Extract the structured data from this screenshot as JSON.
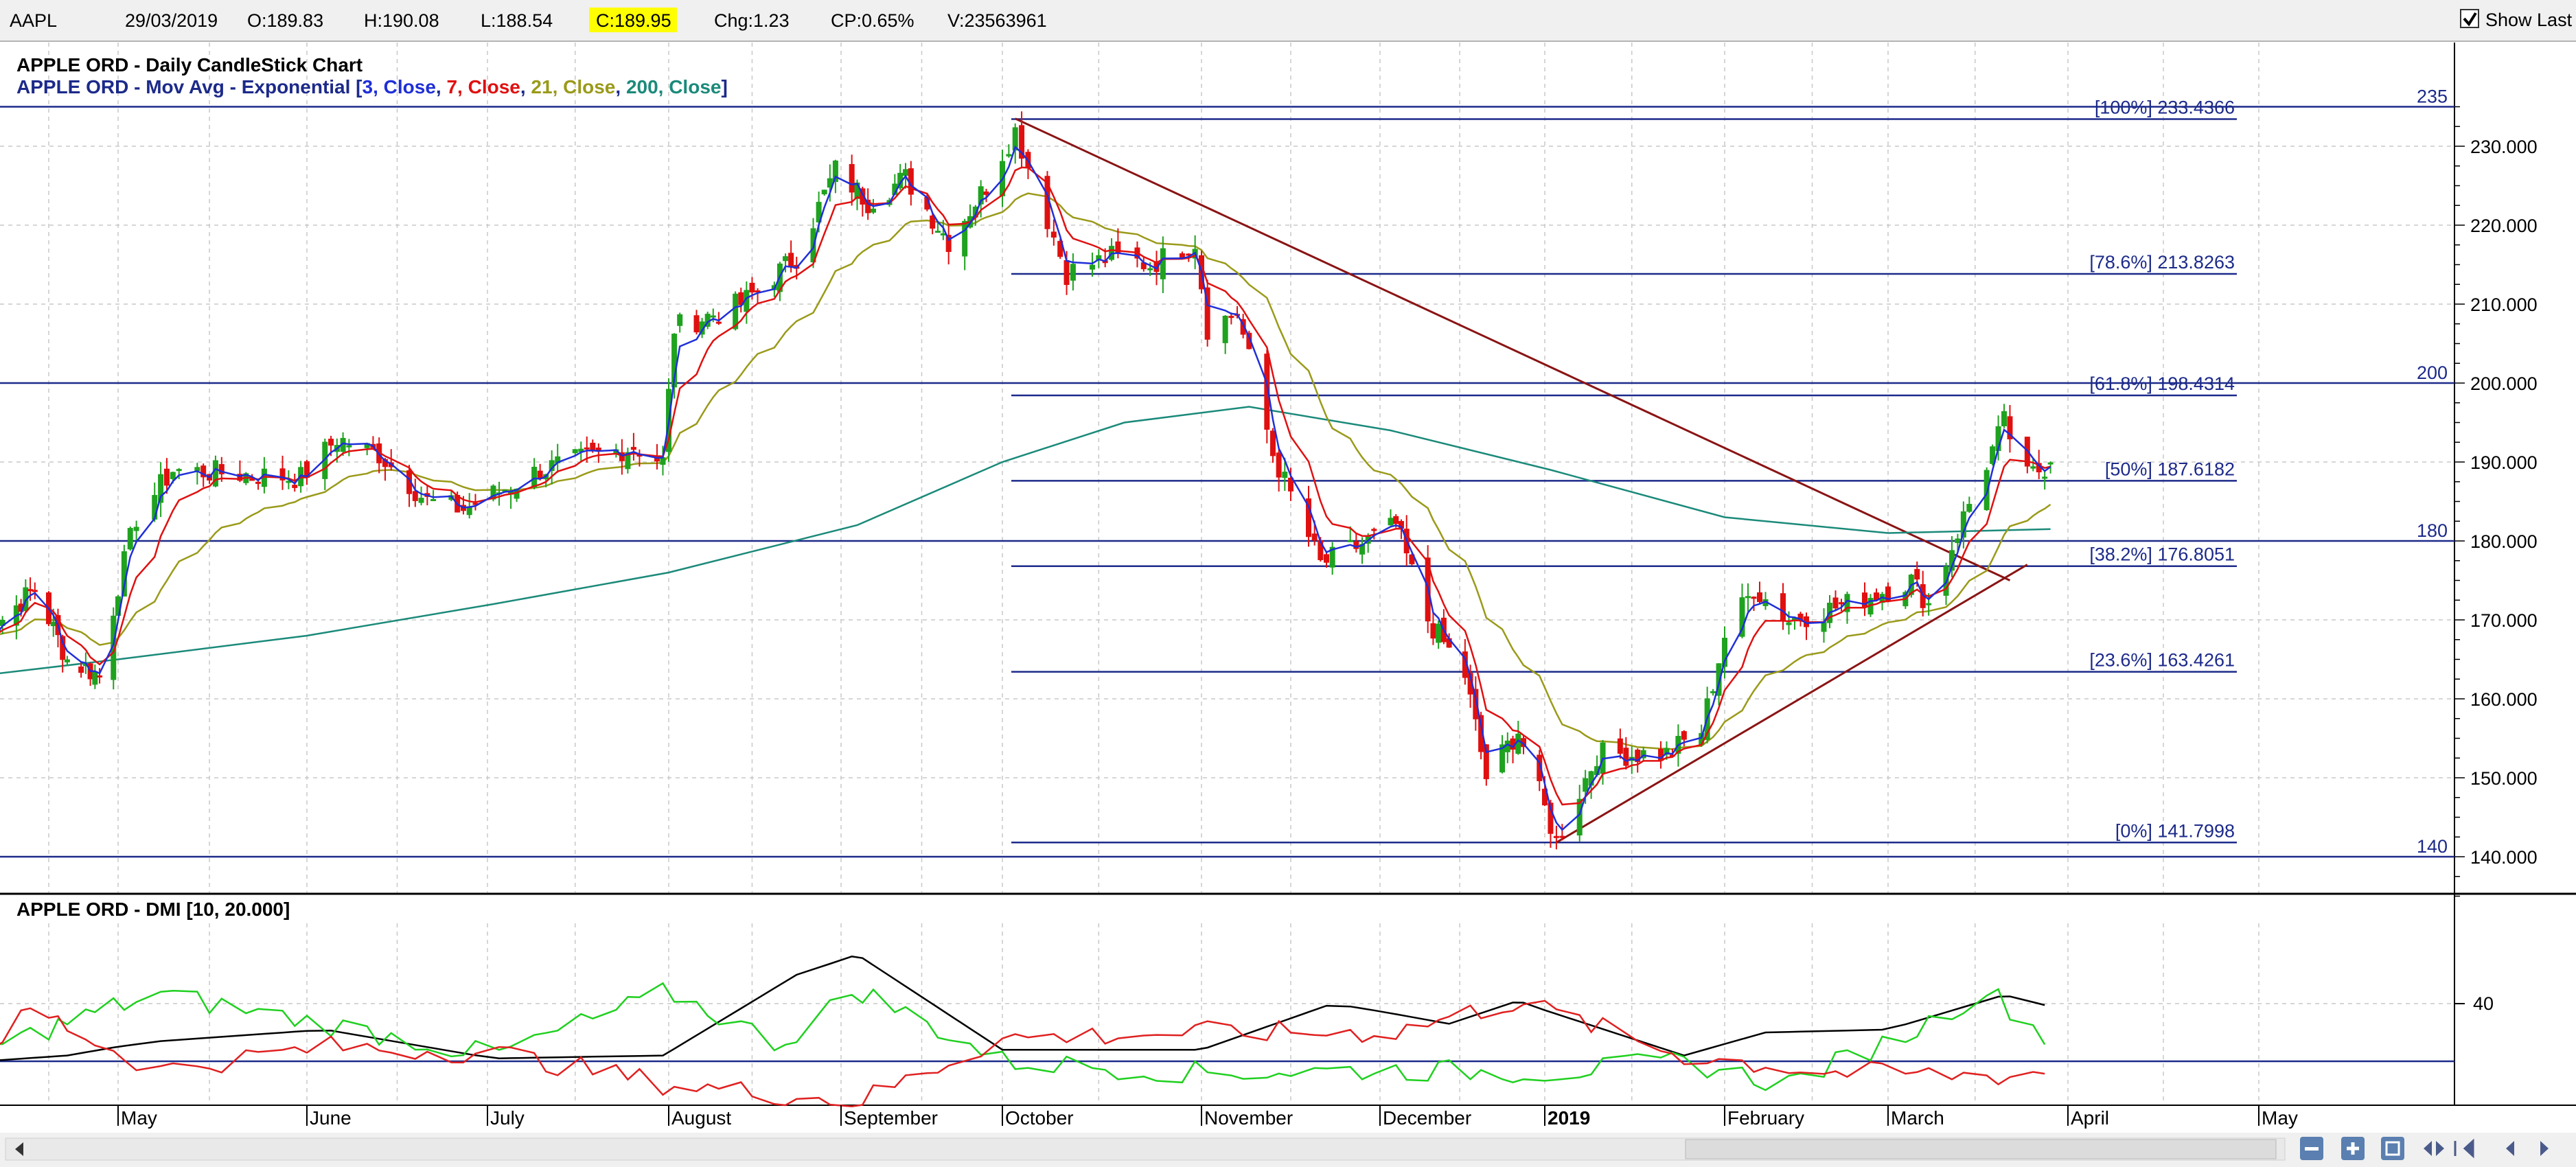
{
  "topbar": {
    "symbol": "AAPL",
    "date": "29/03/2019",
    "open": "O:189.83",
    "high": "H:190.08",
    "low": "L:188.54",
    "close": "C:189.95",
    "change": "Chg:1.23",
    "change_pct": "CP:0.65%",
    "volume": "V:23563961",
    "show_last_label": "Show Last",
    "show_last_checked": true
  },
  "colors": {
    "up_candle": "#1fa21f",
    "down_candle": "#e01010",
    "ema3": "#1f2fd8",
    "ema7": "#e01010",
    "ema21": "#9a9a1a",
    "ema200": "#1b8a7a",
    "fib_line": "#1c2a8a",
    "trendline": "#8a1414",
    "dmi_adx": "#000000",
    "dmi_plus": "#20d020",
    "dmi_minus": "#e02020",
    "close_highlight": "#ffff00"
  },
  "price_panel": {
    "title_line1": "APPLE ORD - Daily CandleStick Chart",
    "title_line2_prefix": "APPLE ORD - Mov Avg - Exponential [",
    "ema_params": [
      "3, Close",
      "7, Close",
      "21, Close",
      "200, Close"
    ],
    "title_line2_suffix": "]",
    "y_ticks": [
      "140.000",
      "150.000",
      "160.000",
      "170.000",
      "180.000",
      "190.000",
      "200.000",
      "210.000",
      "220.000",
      "230.000"
    ],
    "horizontal_levels": [
      "140",
      "180",
      "200",
      "235"
    ],
    "fib_labels": [
      "[100%] 233.4366",
      "[78.6%] 213.8263",
      "[61.8%] 198.4314",
      "[50%] 187.6182",
      "[38.2%] 176.8051",
      "[23.6%] 163.4261",
      "[0%] 141.7998"
    ]
  },
  "dmi_panel": {
    "title": "APPLE ORD - DMI [10, 20.000]",
    "y_tick": "40"
  },
  "x_axis": {
    "labels": [
      "May",
      "June",
      "July",
      "August",
      "September",
      "October",
      "November",
      "December",
      "2019",
      "February",
      "March",
      "April",
      "May"
    ]
  },
  "chart_data": {
    "type": "candlestick",
    "title": "APPLE ORD - Daily CandleStick Chart",
    "symbol": "AAPL",
    "ylim": [
      135,
      238
    ],
    "last_bar": {
      "date": "29/03/2019",
      "open": 189.83,
      "high": 190.08,
      "low": 188.54,
      "close": 189.95
    },
    "horizontal_lines": [
      140,
      180,
      200,
      235
    ],
    "fibonacci": [
      {
        "label": "[100%] 233.4366",
        "value": 233.4366
      },
      {
        "label": "[78.6%] 213.8263",
        "value": 213.8263
      },
      {
        "label": "[61.8%] 198.4314",
        "value": 198.4314
      },
      {
        "label": "[50%] 187.6182",
        "value": 187.6182
      },
      {
        "label": "[38.2%] 176.8051",
        "value": 176.8051
      },
      {
        "label": "[23.6%] 163.4261",
        "value": 163.4261
      },
      {
        "label": "[0%] 141.7998",
        "value": 141.7998
      }
    ],
    "trendlines": [
      {
        "from": {
          "date": "2018-10-03",
          "value": 233.5
        },
        "to": {
          "date": "2019-03-22",
          "value": 175
        }
      },
      {
        "from": {
          "date": "2019-01-03",
          "value": 141.8
        },
        "to": {
          "date": "2019-03-25",
          "value": 177
        }
      }
    ],
    "close_path": [
      {
        "date": "2018-04-02",
        "value": 168
      },
      {
        "date": "2018-04-13",
        "value": 174
      },
      {
        "date": "2018-04-20",
        "value": 165
      },
      {
        "date": "2018-04-27",
        "value": 163
      },
      {
        "date": "2018-05-04",
        "value": 183
      },
      {
        "date": "2018-05-10",
        "value": 189
      },
      {
        "date": "2018-05-31",
        "value": 188
      },
      {
        "date": "2018-06-06",
        "value": 193
      },
      {
        "date": "2018-06-13",
        "value": 191
      },
      {
        "date": "2018-06-21",
        "value": 185
      },
      {
        "date": "2018-06-27",
        "value": 184
      },
      {
        "date": "2018-07-10",
        "value": 189
      },
      {
        "date": "2018-07-26",
        "value": 192
      },
      {
        "date": "2018-07-31",
        "value": 190
      },
      {
        "date": "2018-08-02",
        "value": 207
      },
      {
        "date": "2018-08-14",
        "value": 210
      },
      {
        "date": "2018-08-24",
        "value": 216
      },
      {
        "date": "2018-08-31",
        "value": 227
      },
      {
        "date": "2018-09-06",
        "value": 223
      },
      {
        "date": "2018-09-13",
        "value": 226
      },
      {
        "date": "2018-09-21",
        "value": 218
      },
      {
        "date": "2018-09-28",
        "value": 225
      },
      {
        "date": "2018-10-03",
        "value": 232
      },
      {
        "date": "2018-10-11",
        "value": 214
      },
      {
        "date": "2018-10-18",
        "value": 216
      },
      {
        "date": "2018-10-24",
        "value": 215
      },
      {
        "date": "2018-10-31",
        "value": 218
      },
      {
        "date": "2018-11-02",
        "value": 207
      },
      {
        "date": "2018-11-07",
        "value": 209
      },
      {
        "date": "2018-11-13",
        "value": 191
      },
      {
        "date": "2018-11-21",
        "value": 177
      },
      {
        "date": "2018-11-29",
        "value": 180
      },
      {
        "date": "2018-12-04",
        "value": 182
      },
      {
        "date": "2018-12-10",
        "value": 170
      },
      {
        "date": "2018-12-17",
        "value": 163
      },
      {
        "date": "2018-12-21",
        "value": 150
      },
      {
        "date": "2018-12-27",
        "value": 156
      },
      {
        "date": "2019-01-03",
        "value": 142
      },
      {
        "date": "2019-01-10",
        "value": 153
      },
      {
        "date": "2019-01-22",
        "value": 153
      },
      {
        "date": "2019-01-28",
        "value": 156
      },
      {
        "date": "2019-02-01",
        "value": 168
      },
      {
        "date": "2019-02-06",
        "value": 174
      },
      {
        "date": "2019-02-12",
        "value": 170
      },
      {
        "date": "2019-02-22",
        "value": 172
      },
      {
        "date": "2019-03-05",
        "value": 175
      },
      {
        "date": "2019-03-08",
        "value": 172
      },
      {
        "date": "2019-03-14",
        "value": 183
      },
      {
        "date": "2019-03-21",
        "value": 195
      },
      {
        "date": "2019-03-25",
        "value": 188
      },
      {
        "date": "2019-03-29",
        "value": 189.95
      }
    ],
    "ema200_path": [
      {
        "date": "2018-04-02",
        "value": 163
      },
      {
        "date": "2018-05-01",
        "value": 165
      },
      {
        "date": "2018-06-01",
        "value": 168
      },
      {
        "date": "2018-07-02",
        "value": 172
      },
      {
        "date": "2018-08-01",
        "value": 176
      },
      {
        "date": "2018-09-04",
        "value": 182
      },
      {
        "date": "2018-10-01",
        "value": 190
      },
      {
        "date": "2018-10-20",
        "value": 195
      },
      {
        "date": "2018-11-09",
        "value": 197
      },
      {
        "date": "2018-12-03",
        "value": 194
      },
      {
        "date": "2019-01-02",
        "value": 189
      },
      {
        "date": "2019-02-01",
        "value": 183
      },
      {
        "date": "2019-03-01",
        "value": 181
      },
      {
        "date": "2019-03-29",
        "value": 181.5
      }
    ],
    "dmi": {
      "params": [
        10,
        20.0
      ],
      "threshold": 20,
      "series": [
        {
          "name": "ADX",
          "points": [
            {
              "date": "2018-04-02",
              "value": 20
            },
            {
              "date": "2018-04-20",
              "value": 22
            },
            {
              "date": "2018-05-08",
              "value": 27
            },
            {
              "date": "2018-06-04",
              "value": 31
            },
            {
              "date": "2018-07-02",
              "value": 21
            },
            {
              "date": "2018-07-31",
              "value": 22
            },
            {
              "date": "2018-08-24",
              "value": 50
            },
            {
              "date": "2018-09-04",
              "value": 57
            },
            {
              "date": "2018-10-01",
              "value": 24
            },
            {
              "date": "2018-11-01",
              "value": 24
            },
            {
              "date": "2018-11-23",
              "value": 40
            },
            {
              "date": "2018-12-14",
              "value": 33
            },
            {
              "date": "2018-12-27",
              "value": 41
            },
            {
              "date": "2019-01-25",
              "value": 22
            },
            {
              "date": "2019-02-08",
              "value": 30
            },
            {
              "date": "2019-03-01",
              "value": 31
            },
            {
              "date": "2019-03-21",
              "value": 43
            },
            {
              "date": "2019-03-29",
              "value": 39
            }
          ]
        },
        {
          "name": "+DI",
          "points": [
            {
              "date": "2018-04-02",
              "value": 24
            },
            {
              "date": "2018-05-08",
              "value": 43
            },
            {
              "date": "2018-06-04",
              "value": 33
            },
            {
              "date": "2018-07-02",
              "value": 22
            },
            {
              "date": "2018-08-01",
              "value": 44
            },
            {
              "date": "2018-08-21",
              "value": 26
            },
            {
              "date": "2018-09-04",
              "value": 45
            },
            {
              "date": "2018-10-01",
              "value": 20
            },
            {
              "date": "2018-11-01",
              "value": 16
            },
            {
              "date": "2018-12-03",
              "value": 17
            },
            {
              "date": "2019-01-02",
              "value": 16
            },
            {
              "date": "2019-01-25",
              "value": 20
            },
            {
              "date": "2019-02-11",
              "value": 12
            },
            {
              "date": "2019-03-05",
              "value": 30
            },
            {
              "date": "2019-03-18",
              "value": 45
            },
            {
              "date": "2019-03-29",
              "value": 27
            }
          ]
        },
        {
          "name": "-DI",
          "points": [
            {
              "date": "2018-04-02",
              "value": 24
            },
            {
              "date": "2018-04-13",
              "value": 38
            },
            {
              "date": "2018-05-08",
              "value": 17
            },
            {
              "date": "2018-06-04",
              "value": 25
            },
            {
              "date": "2018-07-02",
              "value": 23
            },
            {
              "date": "2018-08-01",
              "value": 12
            },
            {
              "date": "2018-09-04",
              "value": 6
            },
            {
              "date": "2018-10-01",
              "value": 28
            },
            {
              "date": "2018-11-01",
              "value": 30
            },
            {
              "date": "2018-12-03",
              "value": 30
            },
            {
              "date": "2018-12-27",
              "value": 41
            },
            {
              "date": "2019-01-25",
              "value": 22
            },
            {
              "date": "2019-02-20",
              "value": 16
            },
            {
              "date": "2019-03-22",
              "value": 15
            },
            {
              "date": "2019-03-29",
              "value": 17
            }
          ]
        }
      ]
    }
  }
}
